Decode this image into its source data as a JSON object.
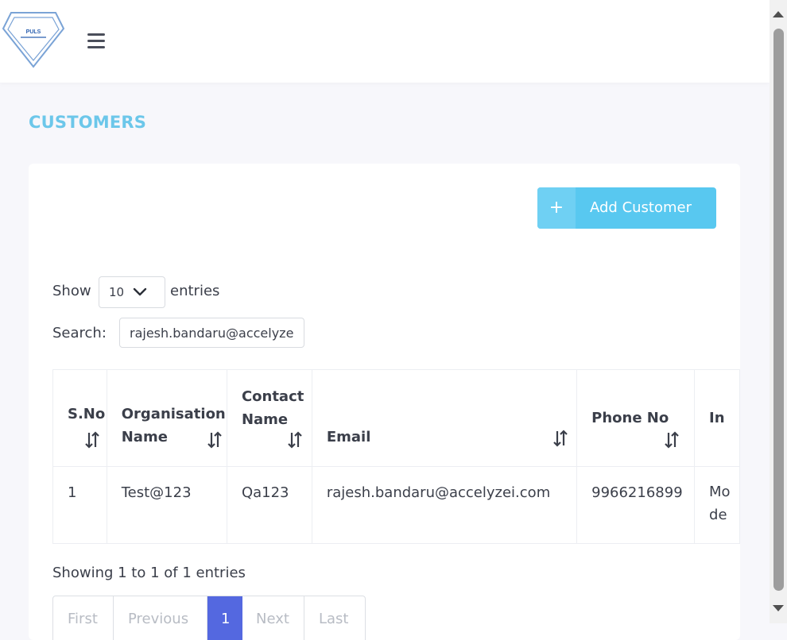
{
  "brand": {
    "logo_text": "PULS"
  },
  "page": {
    "title": "CUSTOMERS"
  },
  "actions": {
    "add_plus": "+",
    "add_label": "Add Customer"
  },
  "length": {
    "show_label": "Show",
    "selected": "10",
    "entries_label": "entries"
  },
  "search": {
    "label": "Search:",
    "value": "rajesh.bandaru@accelyzei.com"
  },
  "table": {
    "columns": [
      {
        "line1": "S.No",
        "line2": ""
      },
      {
        "line1": "Organisation",
        "line2": "Name"
      },
      {
        "line1": "Contact",
        "line2": "Name"
      },
      {
        "line1": "Email",
        "line2": ""
      },
      {
        "line1": "Phone No",
        "line2": ""
      },
      {
        "line1": "In",
        "line2": ""
      }
    ],
    "rows": [
      {
        "sno": "1",
        "organisation": "Test@123",
        "contact": "Qa123",
        "email": "rajesh.bandaru@accelyzei.com",
        "phone": "9966216899",
        "info_line1": "Mo",
        "info_line2": "de"
      }
    ]
  },
  "footer": {
    "info": "Showing 1 to 1 of 1 entries"
  },
  "pagination": {
    "first": "First",
    "previous": "Previous",
    "current": "1",
    "next": "Next",
    "last": "Last"
  },
  "colors": {
    "title": "#6cc7ea",
    "button": "#58c8f0",
    "active_page": "#5468e0"
  }
}
